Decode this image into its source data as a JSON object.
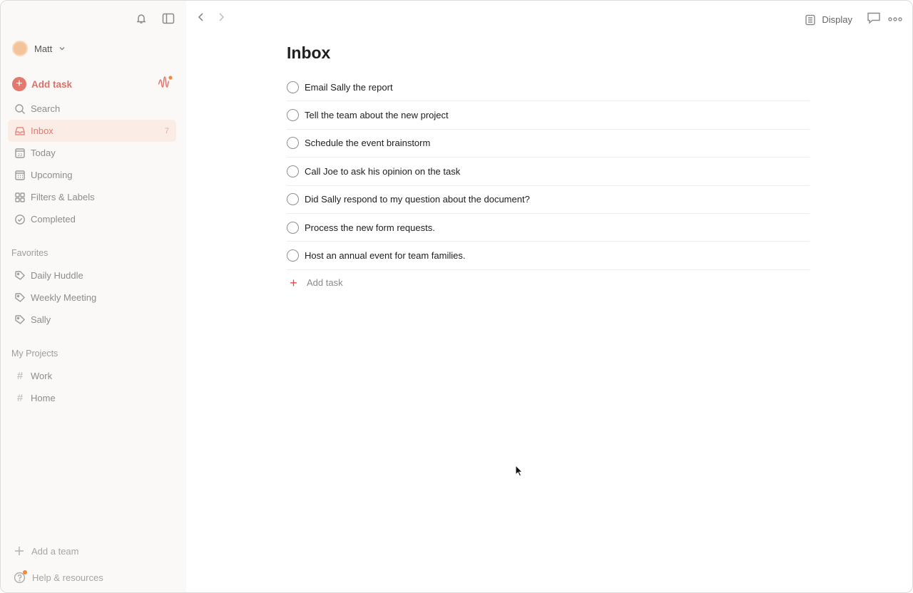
{
  "user": {
    "name": "Matt"
  },
  "sidebar": {
    "add_task_label": "Add task",
    "nav": [
      {
        "label": "Search",
        "icon": "search-icon",
        "count": ""
      },
      {
        "label": "Inbox",
        "icon": "inbox-icon",
        "count": "7",
        "active": true
      },
      {
        "label": "Today",
        "icon": "calendar-today-icon",
        "count": ""
      },
      {
        "label": "Upcoming",
        "icon": "calendar-grid-icon",
        "count": ""
      },
      {
        "label": "Filters & Labels",
        "icon": "filters-icon",
        "count": ""
      },
      {
        "label": "Completed",
        "icon": "check-circle-icon",
        "count": ""
      }
    ],
    "today_day": "22",
    "favorites_title": "Favorites",
    "favorites": [
      "Daily Huddle",
      "Weekly Meeting",
      "Sally"
    ],
    "projects_title": "My Projects",
    "projects": [
      "Work",
      "Home"
    ],
    "add_team_label": "Add a team",
    "help_label": "Help & resources"
  },
  "header": {
    "display_label": "Display"
  },
  "main": {
    "title": "Inbox",
    "tasks": [
      "Email Sally the report",
      "Tell the team about the new project",
      "Schedule the event brainstorm",
      "Call Joe to ask his opinion on the task",
      "Did Sally respond to my question about the document?",
      "Process the new form requests.",
      "Host an annual event for team families."
    ],
    "add_task_label": "Add task"
  },
  "colors": {
    "accent": "#dc4c3e",
    "sidebar_bg": "#fbf9f8",
    "active_bg": "#fbece6"
  }
}
